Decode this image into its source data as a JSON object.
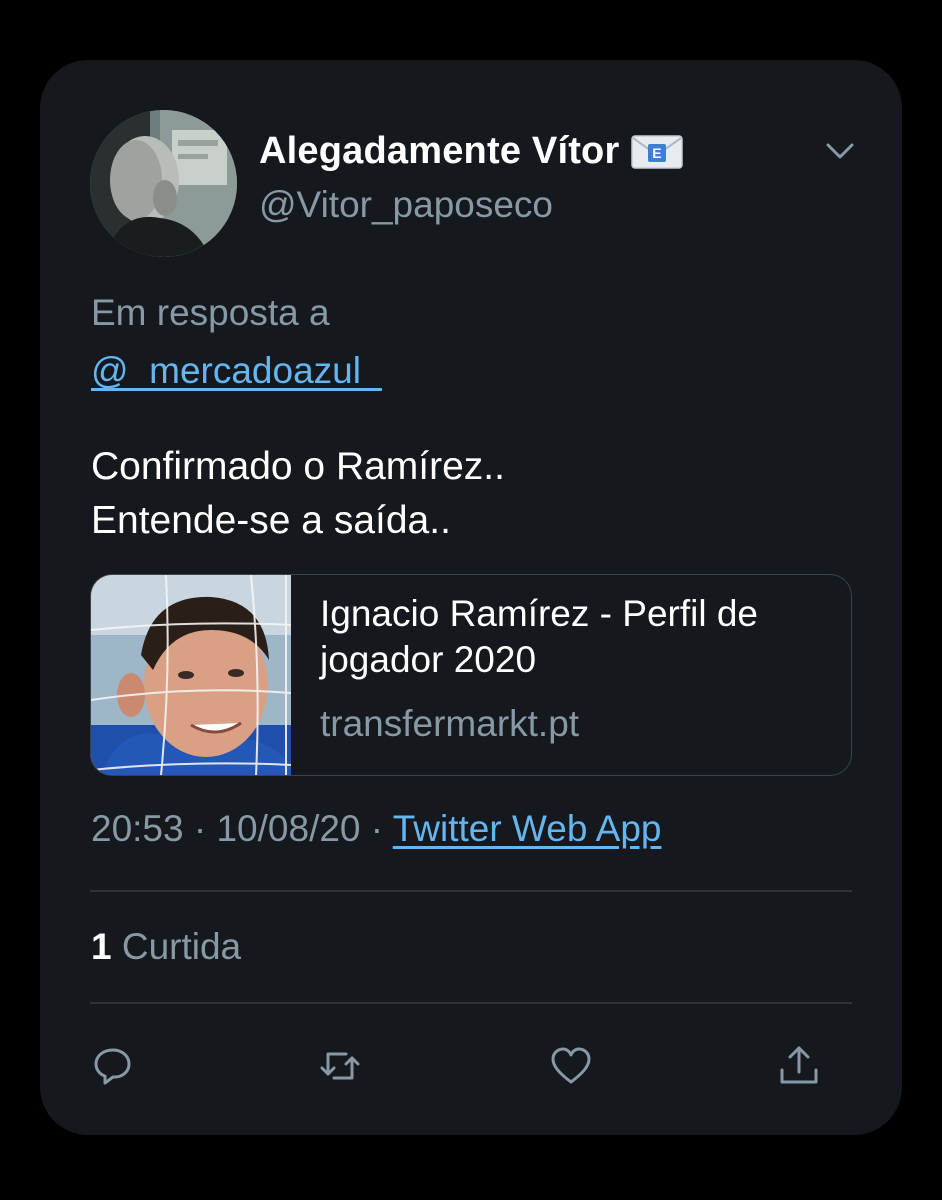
{
  "tweet": {
    "author_name": "Alegadamente Vítor",
    "author_handle": "@Vitor_paposeco",
    "name_emoji_icon": "e-mail-envelope-icon",
    "reply_prefix": "Em resposta a",
    "reply_to": "@_mercadoazul_",
    "text_line_1": "Confirmado o Ramírez..",
    "text_line_2": "Entende-se a saída..",
    "time": "20:53",
    "date": "10/08/20",
    "separator": "·",
    "source": "Twitter Web App"
  },
  "link_card": {
    "title": "Ignacio Ramírez - Perfil de jogador 2020",
    "domain": "transfermarkt.pt"
  },
  "stats": {
    "likes_count": "1",
    "likes_label": "Curtida"
  },
  "actions": [
    {
      "icon": "reply-icon"
    },
    {
      "icon": "retweet-icon"
    },
    {
      "icon": "like-heart-icon"
    },
    {
      "icon": "share-icon"
    }
  ],
  "colors": {
    "background": "#000000",
    "card": "#15181c",
    "link": "#64b5f0",
    "secondary_text": "#8899a6",
    "divider": "#2f3336"
  }
}
